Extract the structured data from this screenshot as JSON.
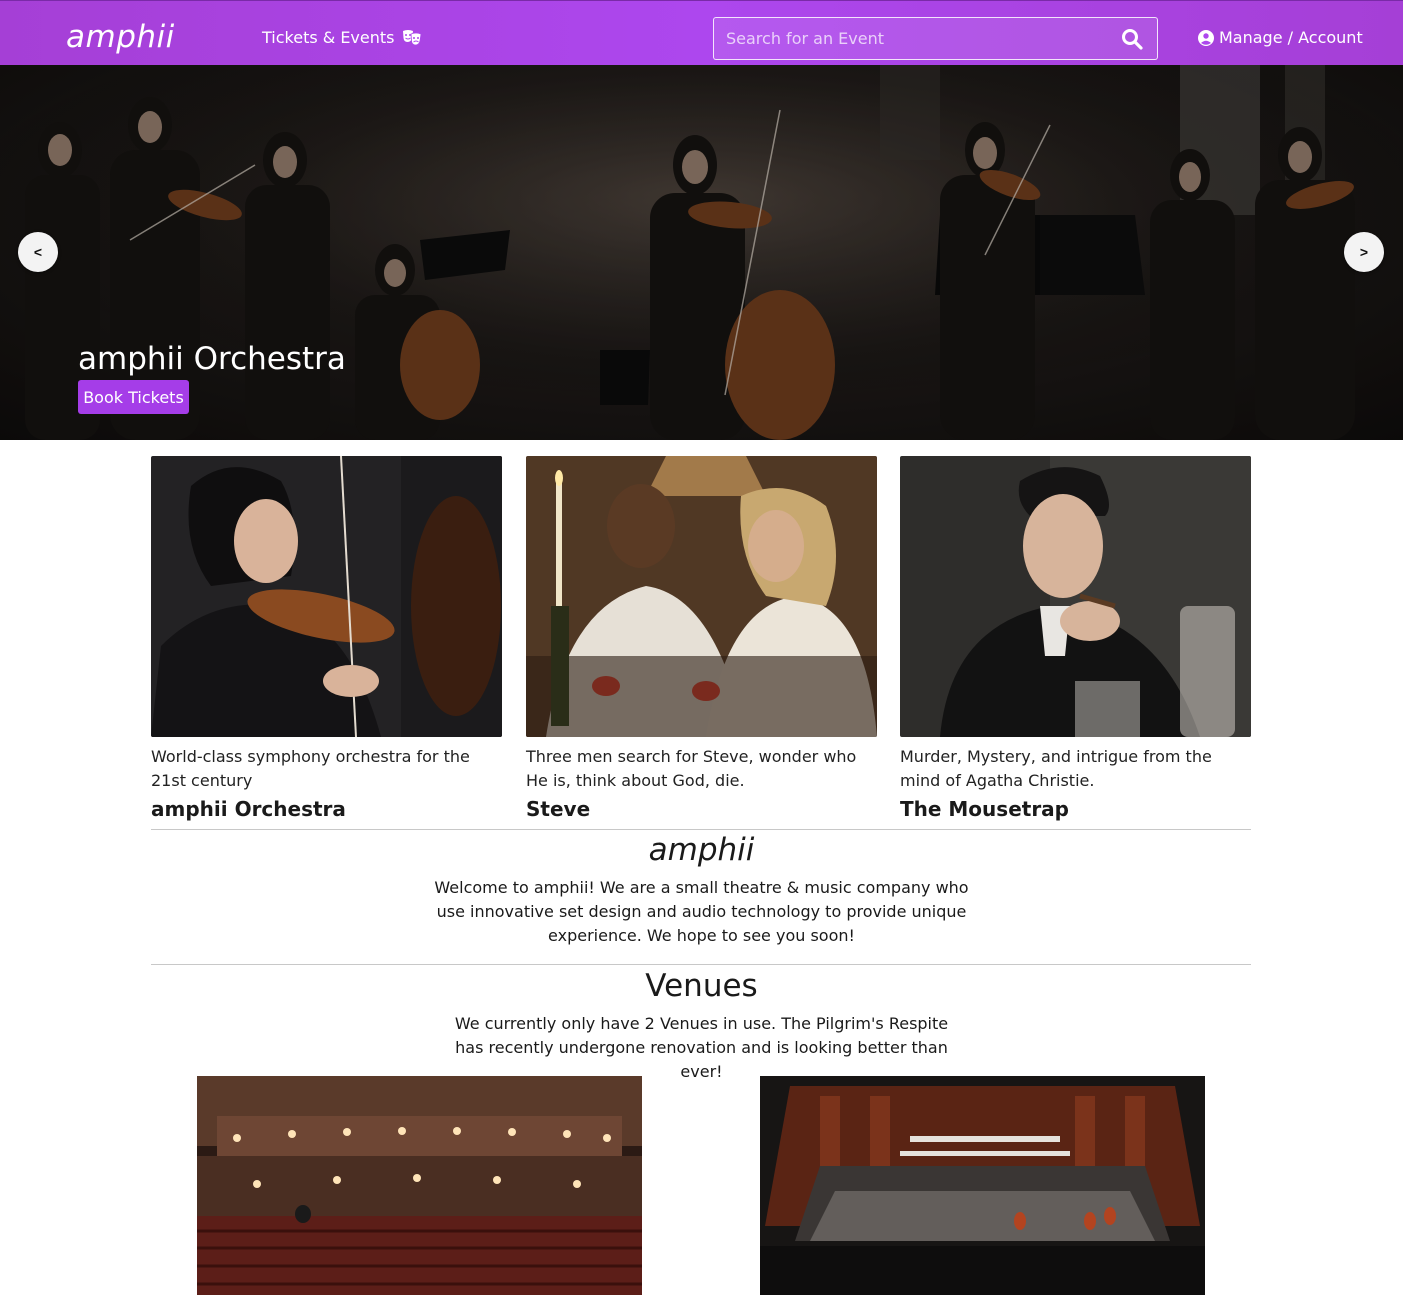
{
  "navbar": {
    "brand": "amphii",
    "tickets_label": "Tickets & Events",
    "search_placeholder": "Search for an Event",
    "account_label": "Manage / Account"
  },
  "hero": {
    "title": "amphii Orchestra",
    "book_label": "Book Tickets",
    "prev_label": "<",
    "next_label": ">"
  },
  "events": [
    {
      "description": "World-class symphony orchestra for the 21st century",
      "title": "amphii Orchestra"
    },
    {
      "description": "Three men search for Steve, wonder who He is, think about God, die.",
      "title": "Steve"
    },
    {
      "description": "Murder, Mystery, and intrigue from the mind of Agatha Christie.",
      "title": "The Mousetrap"
    }
  ],
  "about": {
    "title": "amphii",
    "text": "Welcome to amphii! We are a small theatre & music company who use innovative set design and audio technology to provide unique experience. We hope to see you soon!"
  },
  "venues": {
    "title": "Venues",
    "text": "We currently only have 2 Venues in use. The Pilgrim's Respite has recently undergone renovation and is looking better than ever!"
  },
  "colors": {
    "accent": "#a53de8",
    "navbar": "#ad47ee"
  }
}
